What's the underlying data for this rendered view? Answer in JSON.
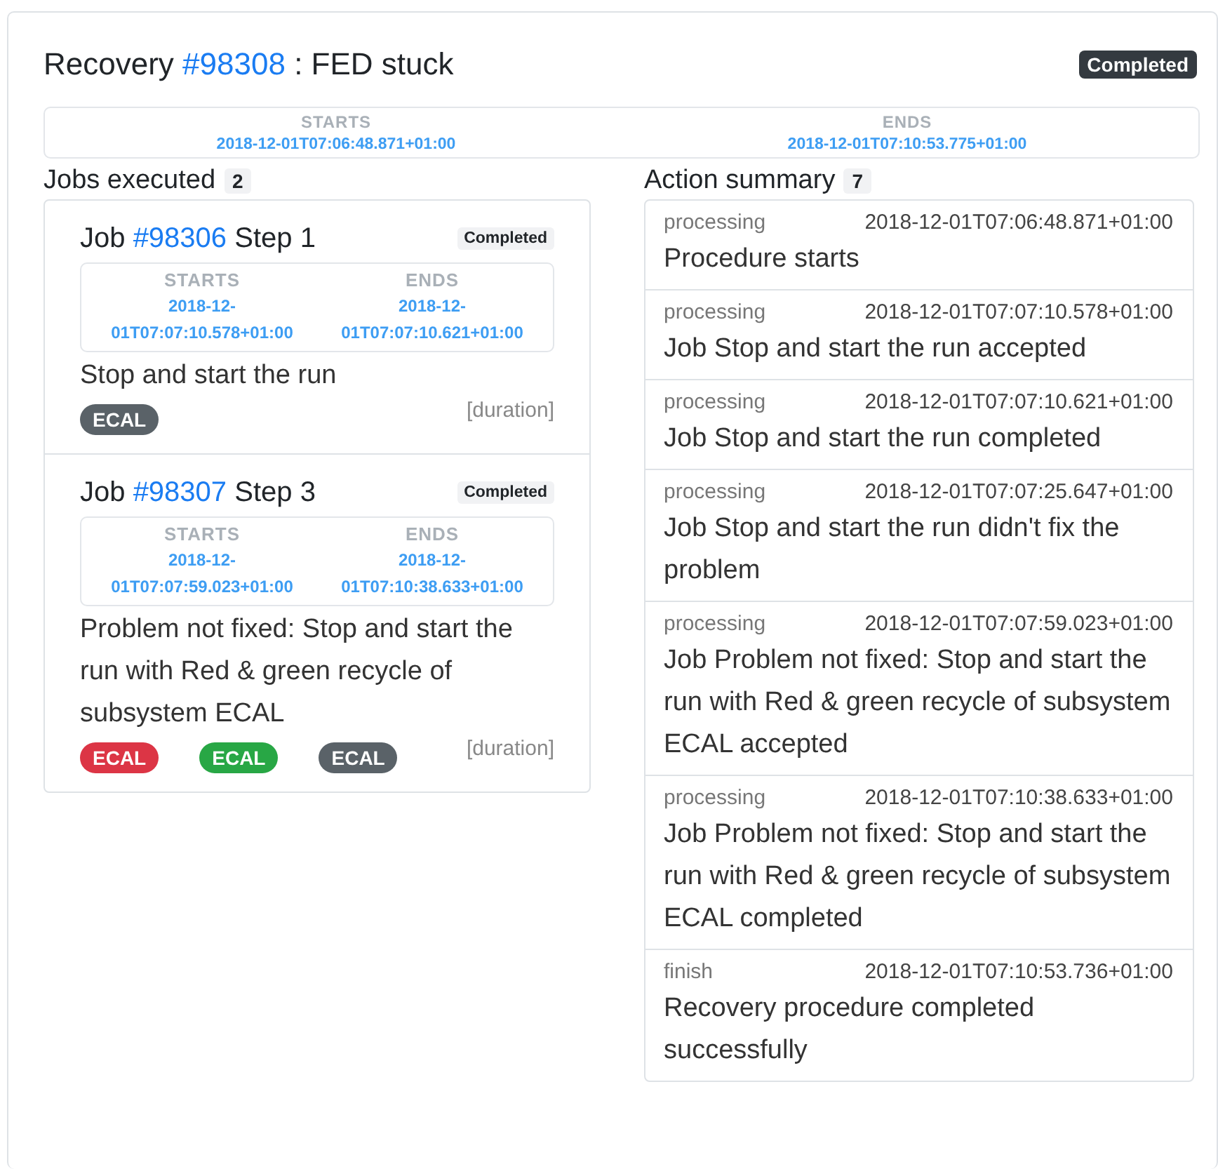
{
  "recovery": {
    "label": "Recovery",
    "id": "#98308",
    "name": ": FED stuck",
    "status": "Completed"
  },
  "period": {
    "starts_label": "STARTS",
    "starts": "2018-12-01T07:06:48.871+01:00",
    "ends_label": "ENDS",
    "ends": "2018-12-01T07:10:53.775+01:00"
  },
  "jobs": {
    "heading": "Jobs executed",
    "count": "2",
    "items": [
      {
        "label": "Job",
        "id": "#98306",
        "step": "Step 1",
        "status": "Completed",
        "starts_label": "STARTS",
        "starts": "2018-12-01T07:07:10.578+01:00",
        "ends_label": "ENDS",
        "ends": "2018-12-01T07:07:10.621+01:00",
        "description": "Stop and start the run",
        "tags": [
          {
            "text": "ECAL",
            "color": "#5a6268"
          }
        ],
        "duration": "[duration]"
      },
      {
        "label": "Job",
        "id": "#98307",
        "step": "Step 3",
        "status": "Completed",
        "starts_label": "STARTS",
        "starts": "2018-12-01T07:07:59.023+01:00",
        "ends_label": "ENDS",
        "ends": "2018-12-01T07:10:38.633+01:00",
        "description": "Problem not fixed: Stop and start the run with Red & green recycle of subsystem ECAL",
        "tags": [
          {
            "text": "ECAL",
            "color": "#dc3545"
          },
          {
            "text": "ECAL",
            "color": "#28a745"
          },
          {
            "text": "ECAL",
            "color": "#5a6268"
          }
        ],
        "duration": "[duration]"
      }
    ]
  },
  "actions": {
    "heading": "Action summary",
    "count": "7",
    "items": [
      {
        "type": "processing",
        "time": "2018-12-01T07:06:48.871+01:00",
        "message": "Procedure starts"
      },
      {
        "type": "processing",
        "time": "2018-12-01T07:07:10.578+01:00",
        "message": "Job Stop and start the run accepted"
      },
      {
        "type": "processing",
        "time": "2018-12-01T07:07:10.621+01:00",
        "message": "Job Stop and start the run completed"
      },
      {
        "type": "processing",
        "time": "2018-12-01T07:07:25.647+01:00",
        "message": "Job Stop and start the run didn't fix the problem"
      },
      {
        "type": "processing",
        "time": "2018-12-01T07:07:59.023+01:00",
        "message": "Job Problem not fixed: Stop and start the run with Red & green recycle of subsystem ECAL accepted"
      },
      {
        "type": "processing",
        "time": "2018-12-01T07:10:38.633+01:00",
        "message": "Job Problem not fixed: Stop and start the run with Red & green recycle of subsystem ECAL completed"
      },
      {
        "type": "finish",
        "time": "2018-12-01T07:10:53.736+01:00",
        "message": "Recovery procedure completed successfully"
      }
    ]
  }
}
